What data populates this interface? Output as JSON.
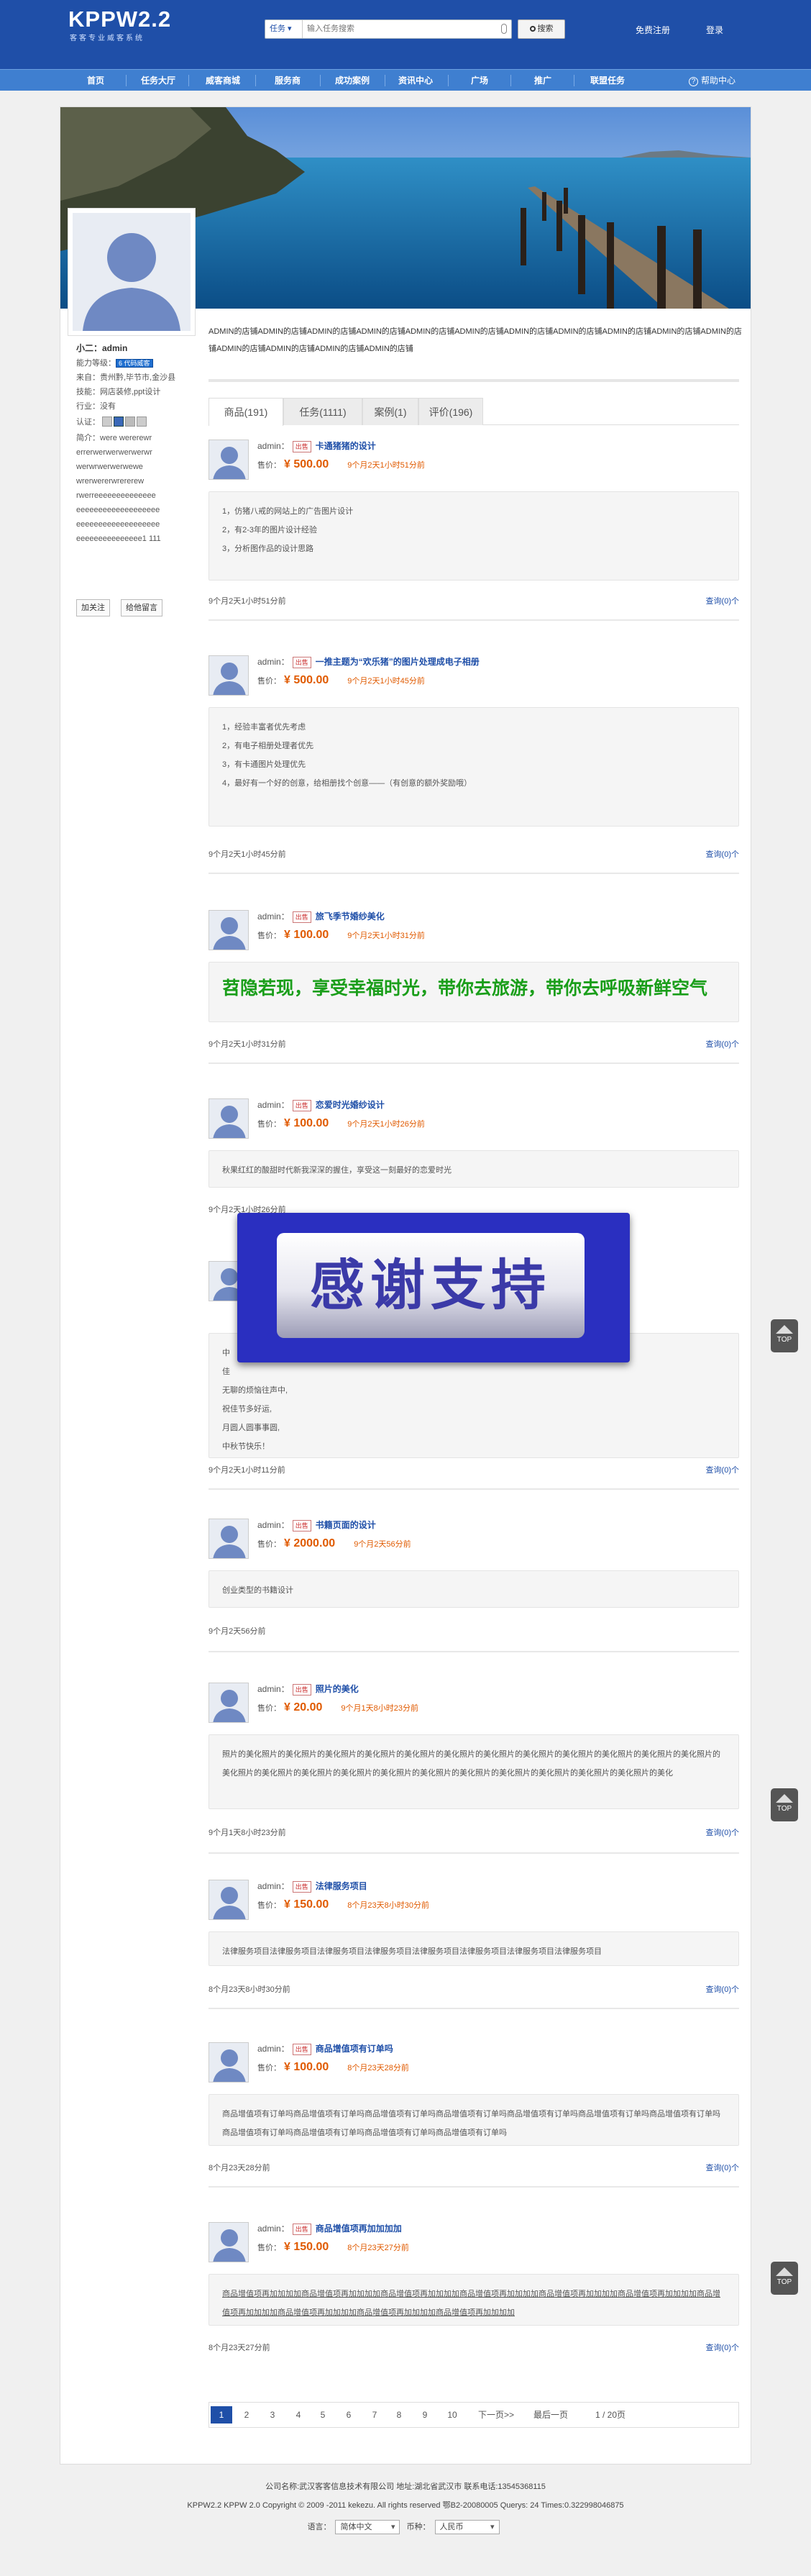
{
  "header": {
    "logo": "KPPW2.2",
    "logo_sub": "客客专业威客系统",
    "search": {
      "scope": "任务",
      "placeholder": "输入任务搜索",
      "button": "搜索"
    },
    "register": "免费注册",
    "login": "登录"
  },
  "nav": {
    "items": [
      "首页",
      "任务大厅",
      "威客商城",
      "服务商",
      "成功案例",
      "资讯中心",
      "广场",
      "推广",
      "联盟任务"
    ],
    "help": "帮助中心"
  },
  "profile": {
    "name": "小二：admin",
    "level_label": "能力等级：",
    "level_badge": "6 代码威客",
    "origin": "来自：贵州黔,毕节市,金沙县",
    "skills": "技能：网店装修,ppt设计",
    "industry": "行业：没有",
    "auth_label": "认证：",
    "intro_lines": [
      "简介：were wererewr",
      "errerwerwerwerwerwr",
      "werwrwerwerwewe",
      "wrerwererwrererew",
      "rwerreeeeeeeeeeeeee",
      "eeeeeeeeeeeeeeeeeee",
      "eeeeeeeeeeeeeeeeeee",
      "eeeeeeeeeeeeeee1 111"
    ],
    "follow_button": "加关注",
    "message_button": "给他留言"
  },
  "shop_desc": "ADMIN的店铺ADMIN的店铺ADMIN的店铺ADMIN的店铺ADMIN的店铺ADMIN的店铺ADMIN的店铺ADMIN的店铺ADMIN的店铺ADMIN的店铺ADMIN的店铺ADMIN的店铺ADMIN的店铺ADMIN的店铺ADMIN的店铺",
  "tabs": [
    {
      "label": "商品(191)",
      "active": true
    },
    {
      "label": "任务(1111)",
      "active": false
    },
    {
      "label": "案例(1)",
      "active": false
    },
    {
      "label": "评价(196)",
      "active": false
    }
  ],
  "price_label": "售价：",
  "bid_label": "查询(0)个",
  "tasks": [
    {
      "user": "admin：",
      "badge": "出售",
      "title": "卡通猪猪的设计",
      "price": "¥ 500.00",
      "time": "9个月2天1小时51分前",
      "lines": [
        "1，仿猪八戒的网站上的广告图片设计",
        "2，有2-3年的图片设计经验",
        "3，分析图作品的设计思路"
      ],
      "ago": "9个月2天1小时51分前",
      "big": false
    },
    {
      "user": "admin：",
      "badge": "出售",
      "title": "一推主题为“欢乐猪”的图片处理成电子相册",
      "price": "¥ 500.00",
      "time": "9个月2天1小时45分前",
      "lines": [
        "1，经验丰富者优先考虑",
        "2，有电子相册处理者优先",
        "3，有卡通图片处理优先",
        "4，最好有一个好的创意，给相册找个创意——（有创意的额外奖励哦）"
      ],
      "ago": "9个月2天1小时45分前",
      "big": false
    },
    {
      "user": "admin：",
      "badge": "出售",
      "title": "旅飞季节婚纱美化",
      "price": "¥ 100.00",
      "time": "9个月2天1小时31分前",
      "lines": [
        "苕隐若现，享受幸福时光，带你去旅游，带你去呼吸新鲜空气"
      ],
      "ago": "9个月2天1小时31分前",
      "big": true
    },
    {
      "user": "admin：",
      "badge": "出售",
      "title": "恋爱时光婚纱设计",
      "price": "¥ 100.00",
      "time": "9个月2天1小时26分前",
      "lines": [
        "秋果红红的酸甜时代新我深深的握住，享受这一刻最好的恋爱时光"
      ],
      "ago": "9个月2天1小时26分前",
      "big": false
    },
    {
      "user": "admin：",
      "badge": "出售",
      "title": "",
      "price": "",
      "time": "",
      "lines": [
        "中",
        "佳",
        "无聊的烦恼往声中,",
        "祝佳节多好运,",
        "月圆人圆事事圆,",
        "中秋节快乐！"
      ],
      "ago": "9个月2天1小时11分前",
      "big": false
    },
    {
      "user": "admin：",
      "badge": "出售",
      "title": "书籍页面的设计",
      "price": "¥ 2000.00",
      "time": "9个月2天56分前",
      "lines": [
        "创业类型的书籍设计"
      ],
      "ago": "9个月2天56分前",
      "big": false
    },
    {
      "user": "admin：",
      "badge": "出售",
      "title": "照片的美化",
      "price": "¥ 20.00",
      "time": "9个月1天8小时23分前",
      "lines": [
        "照片的美化照片的美化照片的美化照片的美化照片的美化照片的美化照片的美化照片的美化照片的美化照片的美化照片的美化照片的美化照片的美化照片的美化照片的美化照片的美化照片的美化照片的美化照片的美化照片的美化照片的美化照片的美化照片的美化照片的美化"
      ],
      "ago": "9个月1天8小时23分前",
      "big": false
    },
    {
      "user": "admin：",
      "badge": "出售",
      "title": "法律服务项目",
      "price": "¥ 150.00",
      "time": "8个月23天8小时30分前",
      "lines": [
        "法律服务项目法律服务项目法律服务项目法律服务项目法律服务项目法律服务项目法律服务项目法律服务项目"
      ],
      "ago": "8个月23天8小时30分前",
      "big": false
    },
    {
      "user": "admin：",
      "badge": "出售",
      "title": "商品增值项有订单吗",
      "price": "¥ 100.00",
      "time": "8个月23天28分前",
      "lines": [
        "商品增值项有订单吗商品增值项有订单吗商品增值项有订单吗商品增值项有订单吗商品增值项有订单吗商品增值项有订单吗商品增值项有订单吗商品增值项有订单吗商品增值项有订单吗商品增值项有订单吗商品增值项有订单吗"
      ],
      "ago": "8个月23天28分前",
      "big": false
    },
    {
      "user": "admin：",
      "badge": "出售",
      "title": "商品增值项再加加加加",
      "price": "¥ 150.00",
      "time": "8个月23天27分前",
      "lines": [
        "商品增值项再加加加加商品增值项再加加加加商品增值项再加加加加商品增值项再加加加加商品增值项再加加加加商品增值项再加加加加商品增值项再加加加加商品增值项再加加加加商品增值项再加加加加商品增值项再加加加加"
      ],
      "ago": "8个月23天27分前",
      "big": false
    }
  ],
  "overlay_text": "感谢支持",
  "pagination": {
    "pages": [
      "1",
      "2",
      "3",
      "4",
      "5",
      "6",
      "7",
      "8",
      "9",
      "10"
    ],
    "current": "1",
    "next": "下一页>>",
    "last": "最后一页",
    "info": "1 / 20页"
  },
  "footer": {
    "line1": "公司名称:武汉客客信息技术有限公司   地址:湖北省武汉市   联系电话:13545368115",
    "line2": "KPPW2.2 KPPW 2.0 Copyright © 2009 -2011 kekezu. All rights reserved 鄂B2-20080005 Querys: 24   Times:0.322998046875",
    "lang_label": "语言：",
    "lang_value": "简体中文",
    "currency_label": "币种：",
    "currency_value": "人民币"
  },
  "totop_label": "TOP",
  "colors": {
    "header_bg": "#1f4fa8",
    "nav_bg": "#3f7fd0",
    "price": "#e05a00",
    "link": "#1f4fa8",
    "highlight_text": "#1a9e1a"
  }
}
